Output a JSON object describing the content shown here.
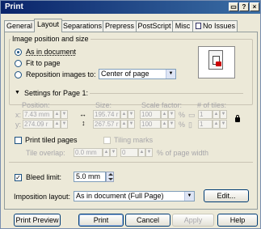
{
  "window": {
    "title": "Print"
  },
  "title_buttons": {
    "help": "?",
    "close": "×"
  },
  "tabs": [
    {
      "label": "General"
    },
    {
      "label": "Layout"
    },
    {
      "label": "Separations"
    },
    {
      "label": "Prepress"
    },
    {
      "label": "PostScript"
    },
    {
      "label": "Misc"
    },
    {
      "label": "No Issues"
    }
  ],
  "image_position": {
    "group_label": "Image position and size",
    "options": [
      {
        "label": "As in document",
        "selected": true
      },
      {
        "label": "Fit to page",
        "selected": false
      },
      {
        "label": "Reposition images to:",
        "selected": false
      }
    ],
    "reposition_value": "Center of page"
  },
  "settings": {
    "label": "Settings for Page 1:",
    "headers": {
      "position": "Position:",
      "size": "Size:",
      "scale": "Scale factor:",
      "tiles": "# of tiles:"
    },
    "x_pos": "7.43 mm",
    "y_pos": "274.09 r",
    "width": "195.74 r",
    "height": "267.57 r",
    "scale_x": "100",
    "scale_y": "100",
    "tiles_x": "1",
    "tiles_y": "1"
  },
  "tiling": {
    "print_tiled_label": "Print tiled pages",
    "print_tiled_checked": false,
    "tiling_marks_label": "Tiling marks",
    "tile_overlap_label": "Tile overlap:",
    "tile_overlap_value": "0.0 mm",
    "tile_percent_value": "0",
    "percent_label": "% of page width"
  },
  "bleed": {
    "label": "Bleed limit:",
    "checked": true,
    "value": "5.0 mm"
  },
  "imposition": {
    "label": "Imposition layout:",
    "value": "As in document (Full Page)",
    "edit_label": "Edit..."
  },
  "footer": {
    "preview": "Print Preview",
    "print": "Print",
    "cancel": "Cancel",
    "apply": "Apply",
    "help": "Help"
  }
}
